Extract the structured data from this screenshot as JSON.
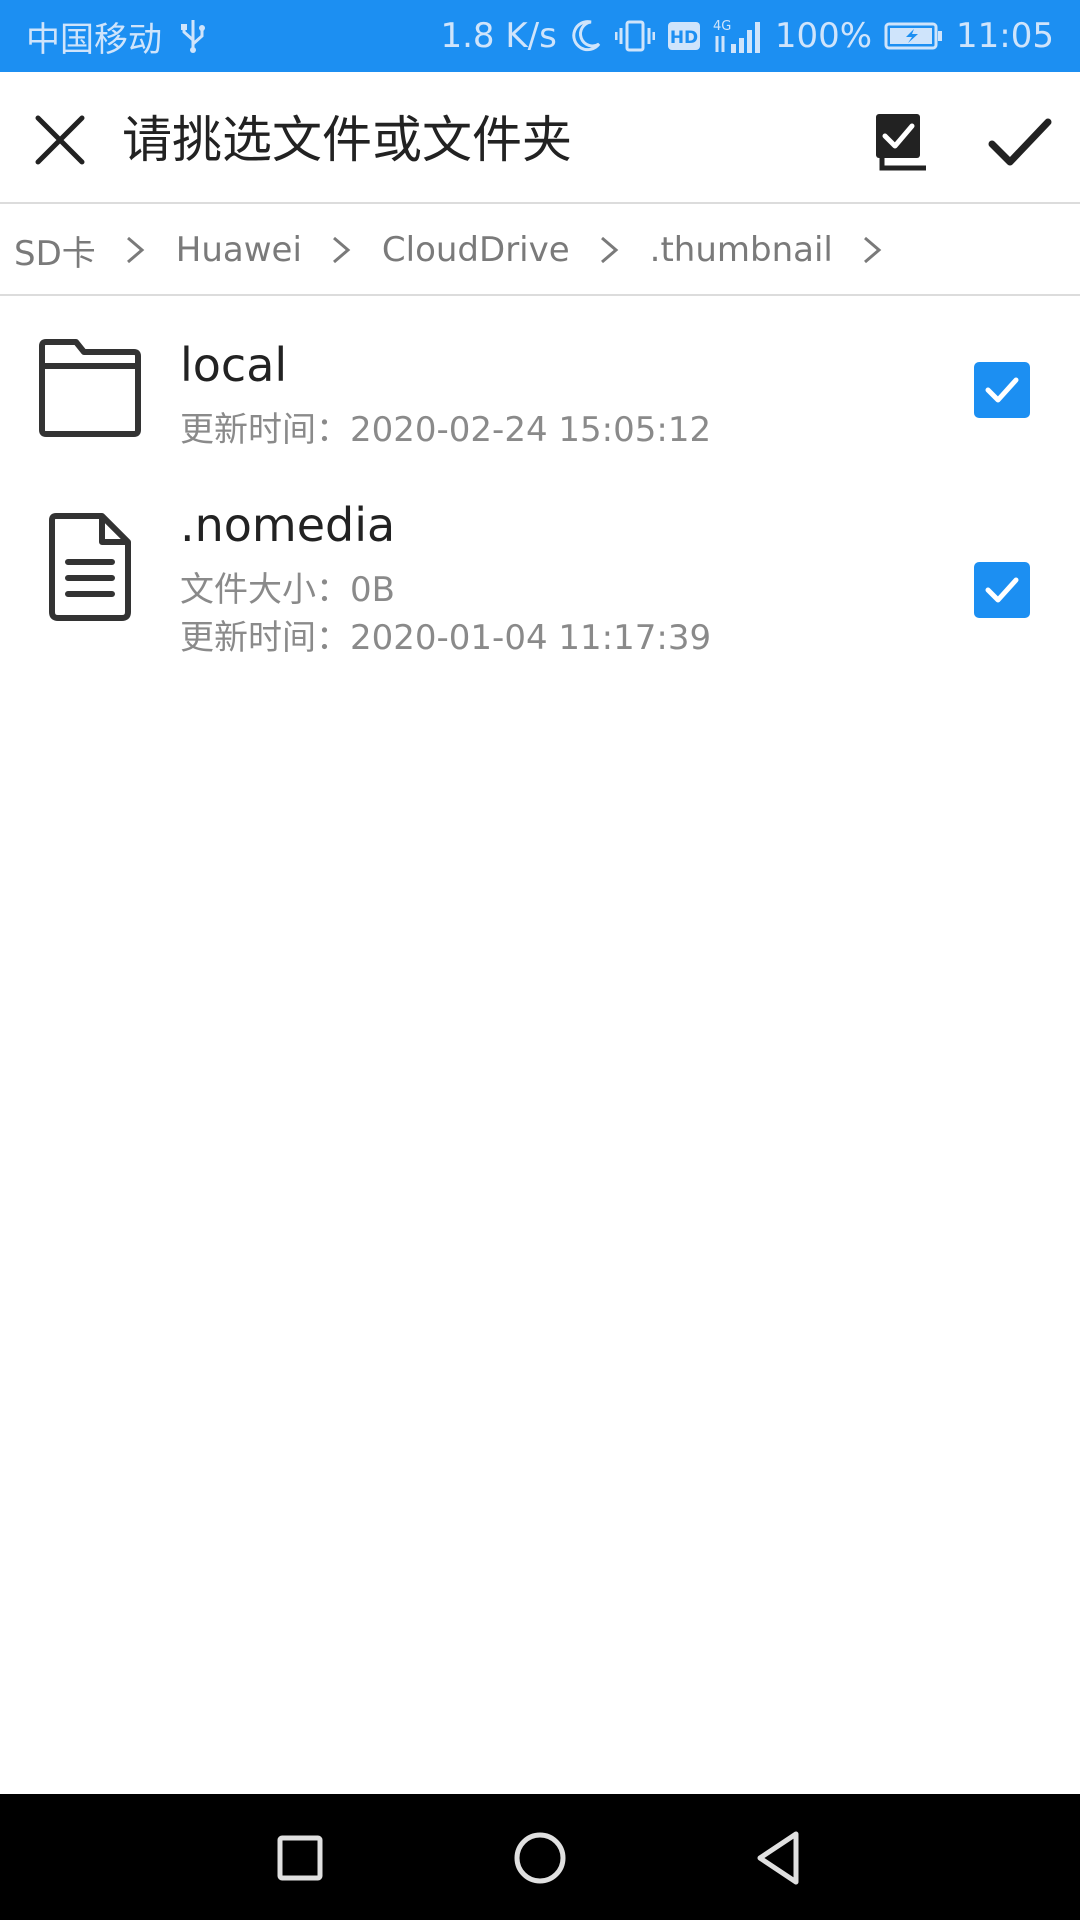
{
  "status_bar": {
    "carrier": "中国移动",
    "net_speed": "1.8 K/s",
    "hd_badge": "HD",
    "network_type": "4G",
    "battery": "100%",
    "time": "11:05"
  },
  "toolbar": {
    "title": "请挑选文件或文件夹"
  },
  "breadcrumb": [
    "SD卡",
    "Huawei",
    "CloudDrive",
    ".thumbnail"
  ],
  "files": [
    {
      "name": "local",
      "type": "folder",
      "updated": "更新时间：2020-02-24 15:05:12",
      "checked": true
    },
    {
      "name": ".nomedia",
      "type": "file",
      "size": "文件大小：0B",
      "updated": "更新时间：2020-01-04 11:17:39",
      "checked": true
    }
  ],
  "colors": {
    "accent": "#1c8ff2",
    "status_bar_text": "#cfe4fb",
    "primary_text": "#222222",
    "secondary_text": "#8a8a8a"
  }
}
